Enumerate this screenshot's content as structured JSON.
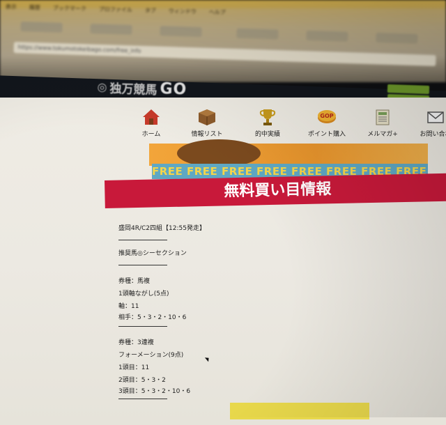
{
  "browser": {
    "menu": [
      "表示",
      "履歴",
      "ブックマーク",
      "プロファイル",
      "タブ",
      "ウィンドウ",
      "ヘルプ"
    ],
    "address": "https://www.tokumotokeibago.com/free_info"
  },
  "site": {
    "logo_text": "独万競馬",
    "logo_go": "GO"
  },
  "nav": {
    "items": [
      {
        "label": "ホーム",
        "icon": "house-icon"
      },
      {
        "label": "情報リスト",
        "icon": "box-icon"
      },
      {
        "label": "的中実績",
        "icon": "trophy-icon"
      },
      {
        "label": "ポイント購入",
        "icon": "gop-coin-icon"
      },
      {
        "label": "メルマガ+",
        "icon": "newsletter-icon"
      },
      {
        "label": "お問い合わ",
        "icon": "mail-icon"
      }
    ]
  },
  "banner": {
    "free_text": "FREE FREE FREE FREE FREE FREE FREE FREE",
    "title": "無料買い目情報"
  },
  "info": {
    "race": "盛岡4R/C2四組【12:55発走】",
    "recommended": "推奨馬◎シーセクション",
    "bet1": {
      "type": "券種：馬複",
      "method": "1頭軸ながし(5点)",
      "axis": "軸：11",
      "partners": "相手：5・3・2・10・6"
    },
    "bet2": {
      "type": "券種：3連複",
      "method": "フォーメーション(9点)",
      "first": "1頭目：11",
      "second": "2頭目：5・3・2",
      "third": "3頭目：5・3・2・10・6"
    }
  },
  "colors": {
    "title_red": "#c8193a",
    "free_blue": "#5fa8c3",
    "free_yellow": "#f4d54a",
    "header_dark": "#12161c"
  }
}
